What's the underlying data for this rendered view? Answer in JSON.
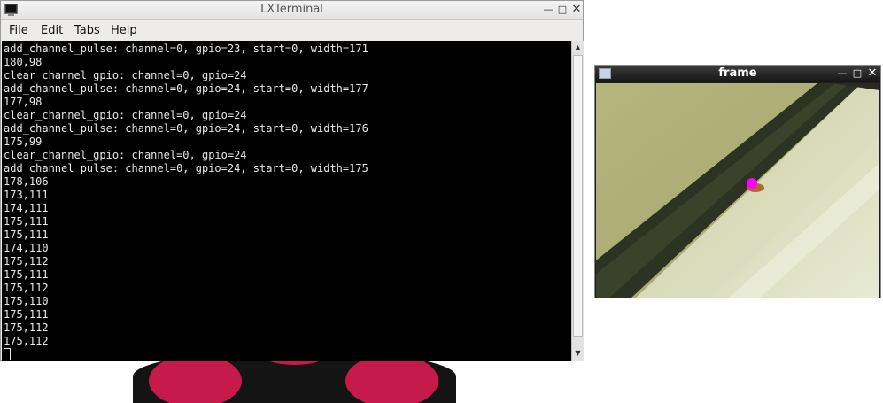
{
  "terminal": {
    "title": "LXTerminal",
    "menus": [
      {
        "label": "File",
        "key": "F",
        "rest": "ile"
      },
      {
        "label": "Edit",
        "key": "E",
        "rest": "dit"
      },
      {
        "label": "Tabs",
        "key": "T",
        "rest": "abs"
      },
      {
        "label": "Help",
        "key": "H",
        "rest": "elp"
      }
    ],
    "lines": [
      "add_channel_pulse: channel=0, gpio=23, start=0, width=171",
      "180,98",
      "clear_channel_gpio: channel=0, gpio=24",
      "add_channel_pulse: channel=0, gpio=24, start=0, width=177",
      "177,98",
      "clear_channel_gpio: channel=0, gpio=24",
      "add_channel_pulse: channel=0, gpio=24, start=0, width=176",
      "175,99",
      "clear_channel_gpio: channel=0, gpio=24",
      "add_channel_pulse: channel=0, gpio=24, start=0, width=175",
      "178,106",
      "173,111",
      "174,111",
      "175,111",
      "175,111",
      "174,110",
      "175,112",
      "175,111",
      "175,112",
      "175,110",
      "175,111",
      "175,112",
      "175,112"
    ]
  },
  "frame": {
    "title": "frame",
    "marker_color": "#ff00ff"
  },
  "icons": {
    "minimize": "minimize-icon",
    "maximize": "maximize-icon",
    "close": "close-icon"
  }
}
